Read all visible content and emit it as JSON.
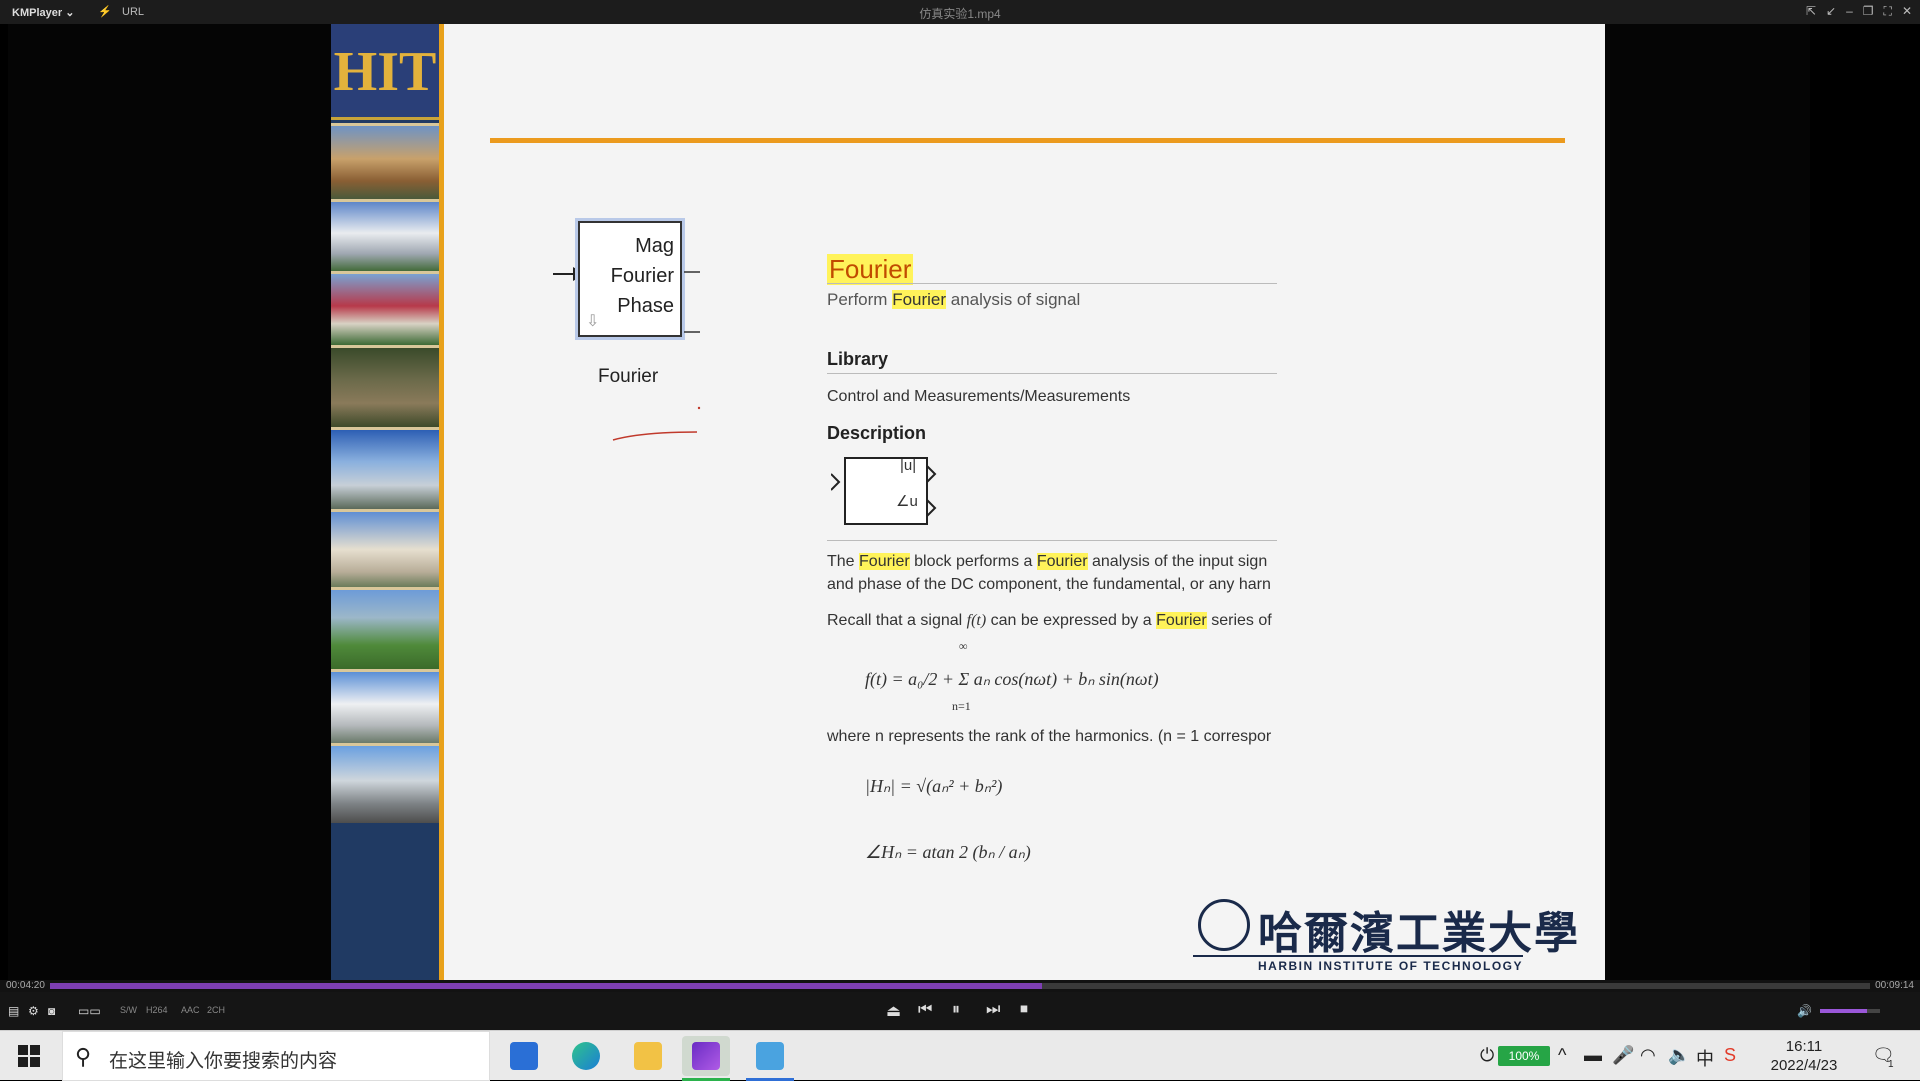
{
  "titlebar": {
    "brand": "KMPlayer ⌄",
    "url": "URL",
    "window_title": "仿真实验1.mp4"
  },
  "slide": {
    "logo_text": "HIT",
    "block": {
      "port_mag": "Mag",
      "port_fourier": "Fourier",
      "port_phase": "Phase",
      "name": "Fourier"
    },
    "doc": {
      "title": "Fourier",
      "subtitle_pre": "Perform ",
      "subtitle_hl": "Fourier",
      "subtitle_post": " analysis of signal",
      "library_heading": "Library",
      "library_path": "Control and Measurements/Measurements",
      "description_heading": "Description",
      "desc_block_mag": "|u|",
      "desc_block_phase": "∠u",
      "para1_a": "The ",
      "para1_hl1": "Fourier",
      "para1_b": " block performs a ",
      "para1_hl2": "Fourier",
      "para1_c": " analysis of the input sign",
      "para1_line2": "and phase of the DC component, the fundamental, or any harn",
      "para2_a": "Recall that a signal ",
      "para2_ft": "f(t)",
      "para2_b": " can be expressed by a ",
      "para2_hl": "Fourier",
      "para2_c": " series of",
      "eq1": "f(t) = a₀/2 + Σ aₙ cos(nωt) + bₙ sin(nωt)",
      "eq1_sum_top": "∞",
      "eq1_sum_bot": "n=1",
      "para3": "where n represents the rank of the harmonics. (n = 1 correspor",
      "eq2": "|Hₙ| = √(aₙ² + bₙ²)",
      "eq3": "∠Hₙ = atan 2 (bₙ / aₙ)"
    },
    "university": {
      "cn": "哈爾濱工業大學",
      "en": "HARBIN INSTITUTE OF TECHNOLOGY"
    }
  },
  "player": {
    "time_current": "00:04:20",
    "time_total": "00:09:14",
    "progress": 0.545,
    "volume": 0.78,
    "small_buttons": [
      "S/W",
      "H264",
      "AAC",
      "2CH"
    ]
  },
  "taskbar": {
    "search_placeholder": "在这里输入你要搜索的内容",
    "battery": "100%",
    "time": "16:11",
    "date": "2022/4/23",
    "notification_count": "1",
    "apps": [
      "mail-icon",
      "edge-icon",
      "file-explorer-icon",
      "kmplayer-icon",
      "app-icon"
    ]
  },
  "colors": {
    "accent": "#eb9a1e",
    "progress": "#7e3fb4",
    "highlight": "#fff35a"
  }
}
